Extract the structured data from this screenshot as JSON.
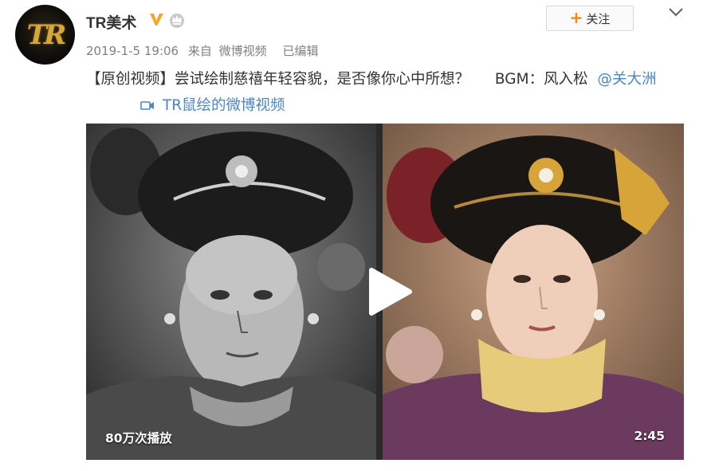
{
  "author": {
    "name": "TR美术",
    "avatar_text": "TR",
    "badge_icon": "verified-v-icon",
    "member_icon": "member-crown-icon"
  },
  "follow_button": {
    "label": "关注",
    "icon": "plus-icon"
  },
  "menu_icon": "chevron-down-icon",
  "meta": {
    "time": "2019-1-5 19:06",
    "source_prefix": "来自",
    "source": "微博视频",
    "edited": "已编辑"
  },
  "post": {
    "text": "【原创视频】尝试绘制慈禧年轻容貌，是否像你心中所想？",
    "bgm": "BGM：风入松",
    "mention": "@关大洲",
    "video_link": "TR鼠绘的微博视频"
  },
  "video": {
    "view_count": "80万次播放",
    "duration": "2:45",
    "play_icon": "play-icon"
  },
  "colors": {
    "accent_orange": "#ff8200",
    "link_blue": "#4b86c5",
    "meta_gray": "#808080"
  }
}
